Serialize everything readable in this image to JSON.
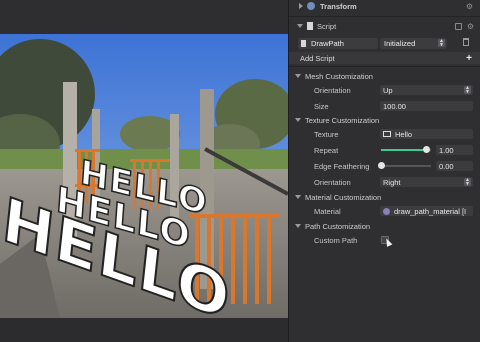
{
  "inspector": {
    "transform_label": "Transform",
    "script_label": "Script",
    "script_name": "DrawPath",
    "script_state": "Initialized",
    "add_script_label": "Add Script",
    "add_symbol": "+",
    "mesh": {
      "header": "Mesh Customization",
      "orientation_label": "Orientation",
      "orientation_value": "Up",
      "size_label": "Size",
      "size_value": "100.00"
    },
    "texture": {
      "header": "Texture Customization",
      "texture_label": "Texture",
      "texture_value": "Hello",
      "repeat_label": "Repeat",
      "repeat_value": "1.00",
      "repeat_slider_fraction": 0.9,
      "feather_label": "Edge Feathering",
      "feather_value": "0.00",
      "orientation_label": "Orientation",
      "orientation_value": "Right"
    },
    "material": {
      "header": "Material Customization",
      "material_label": "Material",
      "material_value": "draw_path_material [I"
    },
    "path": {
      "header": "Path Customization",
      "custom_path_label": "Custom Path"
    }
  },
  "preview": {
    "overlay_text": "HELLO"
  }
}
